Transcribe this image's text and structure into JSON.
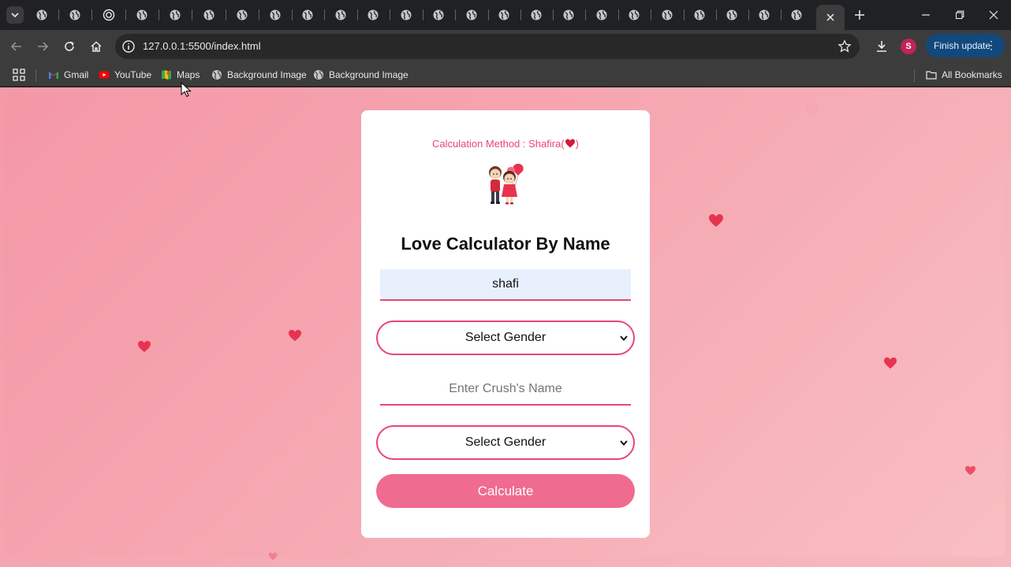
{
  "browser": {
    "tab_count_visible": 24,
    "url": "127.0.0.1:5500/index.html",
    "avatar_letter": "S",
    "update_button_label": "Finish update",
    "bookmarks": [
      {
        "label": "Gmail",
        "icon": "gmail-icon"
      },
      {
        "label": "YouTube",
        "icon": "youtube-icon"
      },
      {
        "label": "Maps",
        "icon": "maps-icon"
      },
      {
        "label": "Background Image",
        "icon": "globe-icon"
      },
      {
        "label": "Background Image",
        "icon": "globe-icon"
      }
    ],
    "all_bookmarks_label": "All Bookmarks"
  },
  "app": {
    "method_label": "Calculation Method : Shafira(",
    "method_suffix": ")",
    "title": "Love Calculator By Name",
    "your_name_value": "shafi",
    "your_gender_placeholder": "Select Gender",
    "crush_name_placeholder": "Enter Crush's Name",
    "crush_gender_placeholder": "Select Gender",
    "calculate_label": "Calculate"
  },
  "colors": {
    "accent": "#e8457a",
    "button": "#f06b90",
    "background": "#f5aab3",
    "heart": "#e8334f"
  }
}
